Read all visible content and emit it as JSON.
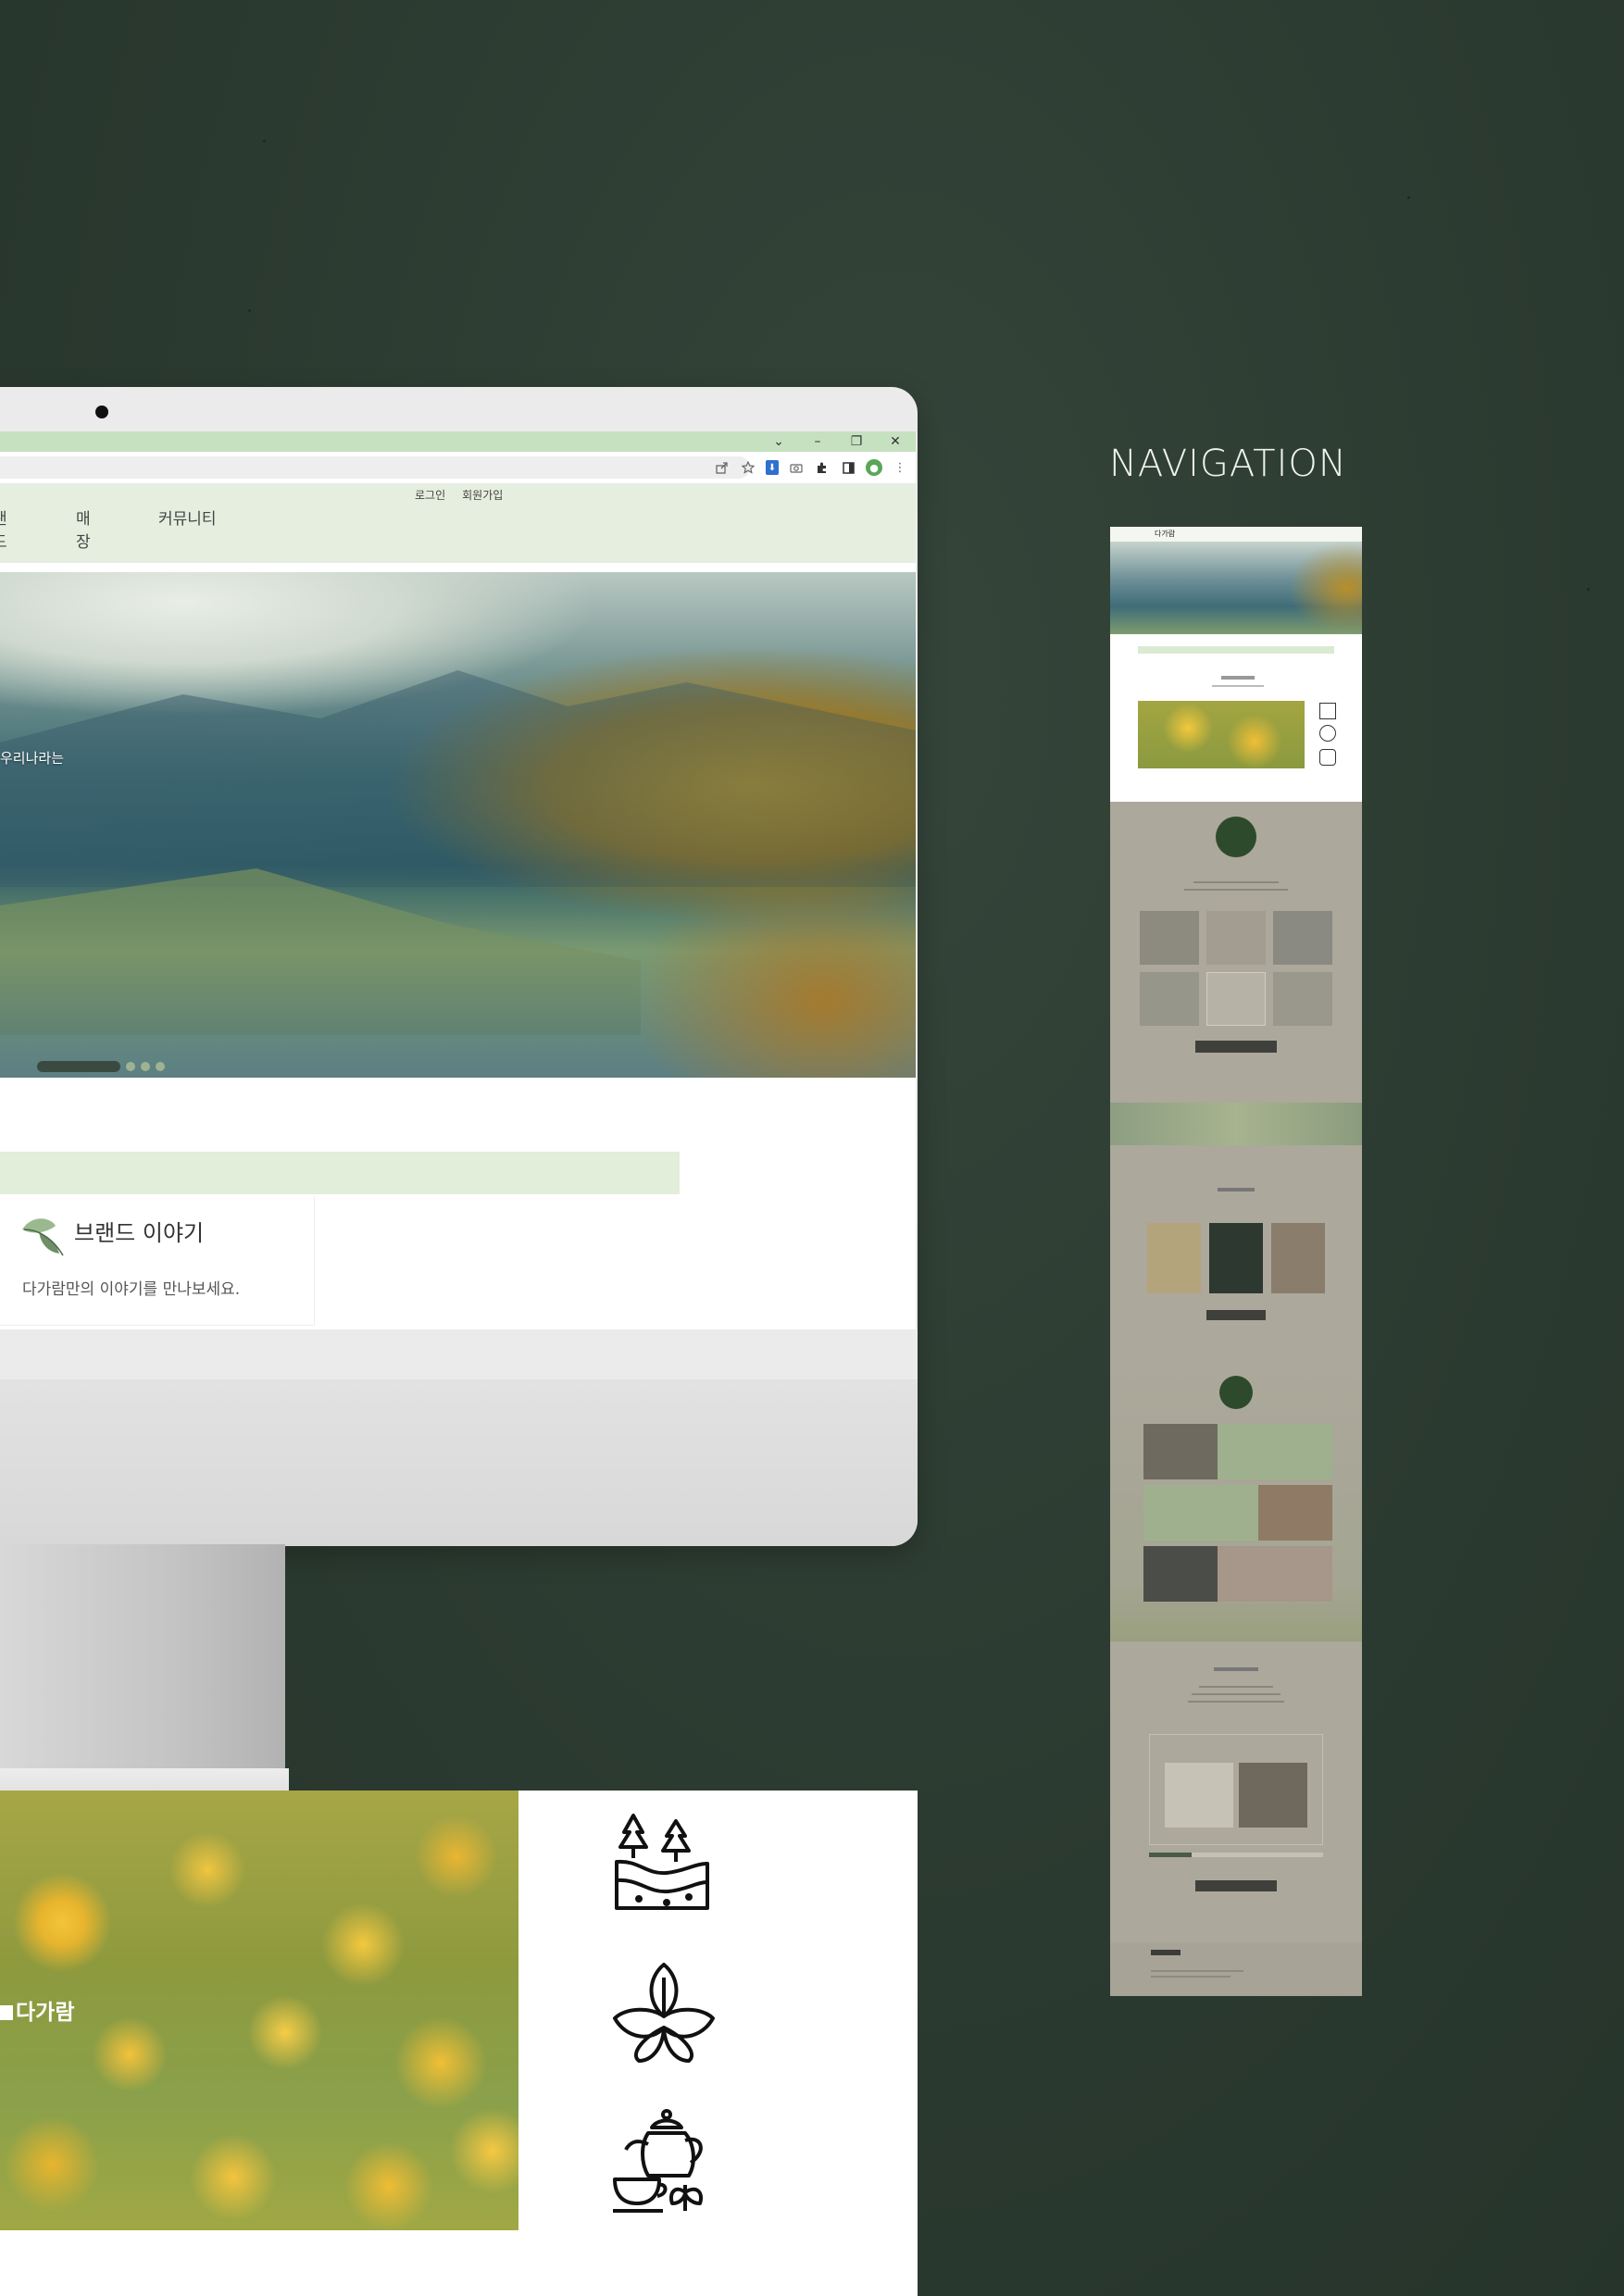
{
  "colors": {
    "background": "#2b3a30",
    "tab_strip": "#c6e1bf",
    "header_bg": "#e6eedf",
    "notice_bar": "#e2eed9",
    "accent_dark_green": "#2e4a2c",
    "thumbnail_overlay": "#aca89c"
  },
  "browser": {
    "window_controls": [
      "⌄",
      "–",
      "❐",
      "✕"
    ],
    "toolbar_icons": [
      "share-icon",
      "star-icon",
      "download-icon",
      "camera-icon",
      "extensions-icon",
      "sidebar-icon",
      "profile-icon",
      "menu-icon"
    ]
  },
  "site": {
    "util_links": {
      "login": "로그인",
      "signup": "회원가입"
    },
    "nav": {
      "brand": "랜드",
      "store": "매장",
      "community": "커뮤니티"
    },
    "hero": {
      "text": "우리나라는",
      "slide_count": 4,
      "active_slide": 1
    },
    "brand_story": {
      "title": "브랜드 이야기",
      "subtitle": "다가람만의 이야기를 만나보세요."
    }
  },
  "lower": {
    "photo_logo": "다가람",
    "feature_icons": [
      "forest-land-icon",
      "tea-leaf-icon",
      "teapot-cup-icon"
    ]
  },
  "navigation_panel": {
    "title": "NAVIGATION",
    "thumbnail_logo": "다가람"
  }
}
